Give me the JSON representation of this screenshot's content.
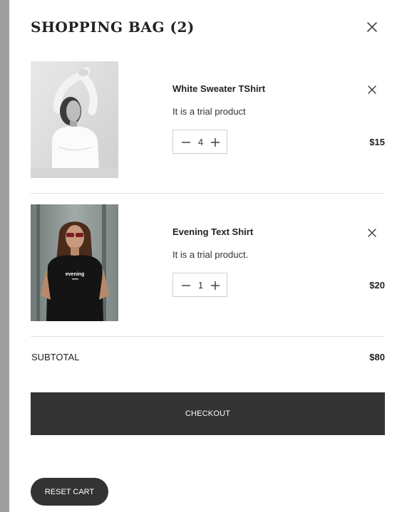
{
  "cart": {
    "title": "SHOPPING BAG (2)",
    "close_icon": "close-icon",
    "items": [
      {
        "name": "White Sweater TShirt",
        "description": "It is a trial product",
        "quantity": "4",
        "price": "$15",
        "image": "woman in white sweater, black and white photo"
      },
      {
        "name": "Evening Text Shirt",
        "description": "It is a trial product.",
        "quantity": "1",
        "price": "$20",
        "image": "woman in black t-shirt with sunglasses",
        "shirt_print": "evening"
      }
    ],
    "subtotal_label": "SUBTOTAL",
    "subtotal_value": "$80",
    "checkout_label": "CHECKOUT",
    "reset_label": "RESET CART"
  },
  "colors": {
    "button_bg": "#333333",
    "overlay": "#9e9e9e",
    "divider": "#e2e2e2"
  }
}
